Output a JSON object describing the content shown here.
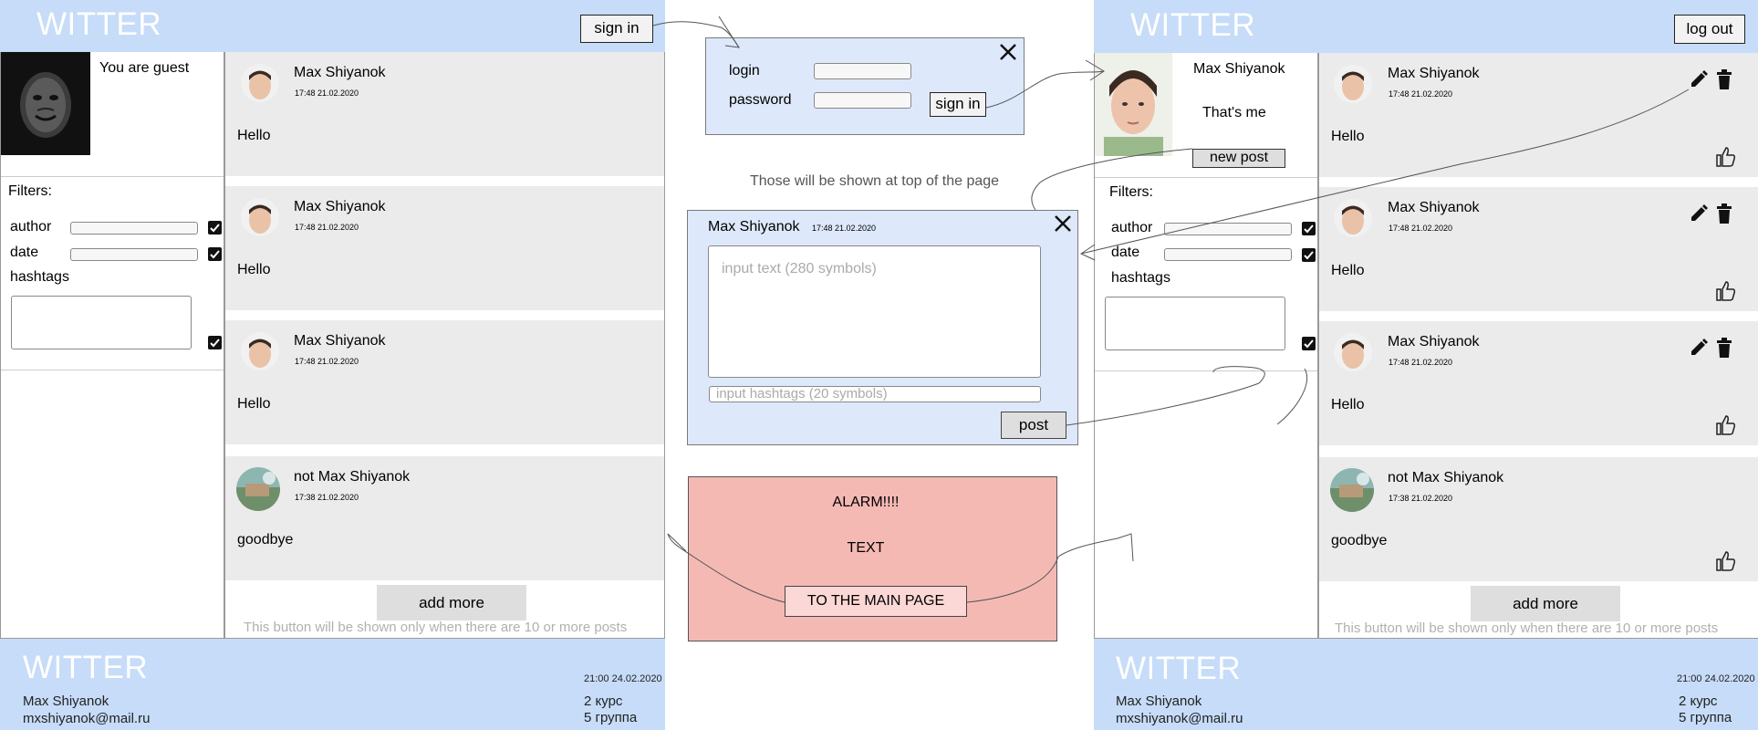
{
  "brand": "WITTER",
  "left_page": {
    "header_button": "sign in",
    "profile_text": "You are guest",
    "filters": {
      "title": "Filters:",
      "author_label": "author",
      "date_label": "date",
      "hashtags_label": "hashtags"
    },
    "posts": [
      {
        "author": "Max Shiyanok",
        "time": "17:48 21.02.2020",
        "text": "Hello"
      },
      {
        "author": "Max Shiyanok",
        "time": "17:48 21.02.2020",
        "text": "Hello"
      },
      {
        "author": "Max Shiyanok",
        "time": "17:48 21.02.2020",
        "text": "Hello"
      },
      {
        "author": "not Max Shiyanok",
        "time": "17:38 21.02.2020",
        "text": "goodbye"
      }
    ],
    "add_more": "add more",
    "add_more_note": "This button will be shown only when there are 10 or more posts"
  },
  "right_page": {
    "header_button": "log out",
    "profile_name": "Max Shiyanok",
    "profile_caption": "That's me",
    "new_post_button": "new post",
    "filters": {
      "title": "Filters:",
      "author_label": "author",
      "date_label": "date",
      "hashtags_label": "hashtags"
    },
    "posts": [
      {
        "author": "Max Shiyanok",
        "time": "17:48 21.02.2020",
        "text": "Hello"
      },
      {
        "author": "Max Shiyanok",
        "time": "17:48 21.02.2020",
        "text": "Hello"
      },
      {
        "author": "Max Shiyanok",
        "time": "17:48 21.02.2020",
        "text": "Hello"
      },
      {
        "author": "not Max Shiyanok",
        "time": "17:38 21.02.2020",
        "text": "goodbye"
      }
    ],
    "add_more": "add more",
    "add_more_note": "This button will be shown only when there are 10 or more posts"
  },
  "login_dialog": {
    "login_label": "login",
    "password_label": "password",
    "submit": "sign in"
  },
  "top_note": "Those will be shown at top of the page",
  "new_post_dialog": {
    "author": "Max Shiyanok",
    "time": "17:48 21.02.2020",
    "text_placeholder": "input text (280 symbols)",
    "hashtags_placeholder": "input hashtags (20 symbols)",
    "submit": "post"
  },
  "alarm_dialog": {
    "title": "ALARM!!!!",
    "text": "TEXT",
    "button": "TO THE MAIN PAGE"
  },
  "footer": {
    "name": "Max Shiyanok",
    "email": "mxshiyanok@mail.ru",
    "datetime": "21:00 24.02.2020",
    "course": "2 курс",
    "group": "5 группа"
  },
  "colors": {
    "header_blue": "#c6dcf8",
    "dialog_blue": "#dde9fb",
    "alarm_pink": "#f5b9b4",
    "post_gray": "#ebebeb"
  }
}
